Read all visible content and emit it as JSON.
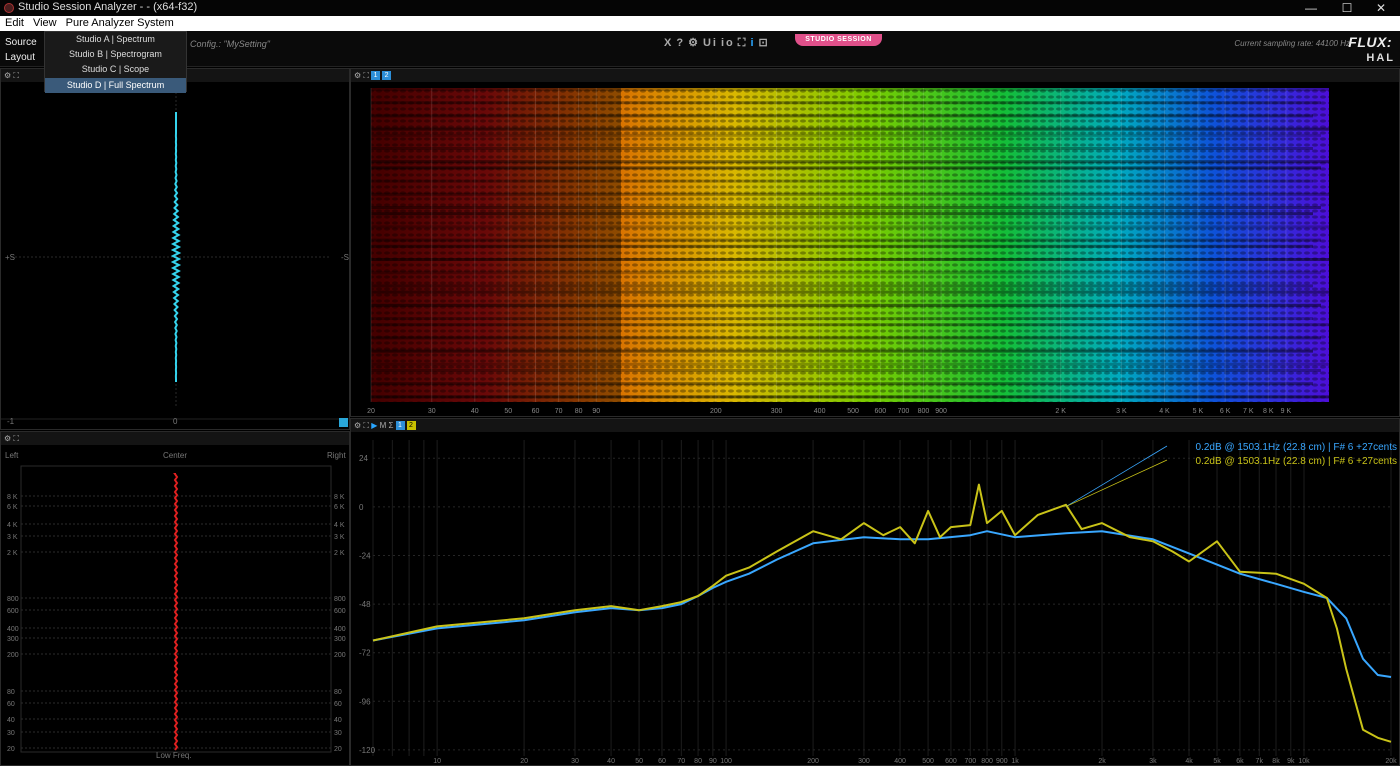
{
  "window": {
    "title": "Studio Session Analyzer -  -  (x64-f32)",
    "minimize": "—",
    "maximize": "☐",
    "close": "✕"
  },
  "menu": {
    "edit": "Edit",
    "view": "View",
    "pure": "Pure Analyzer System"
  },
  "toolbar": {
    "source": "Source",
    "layout": "Layout",
    "config": "Config.: \"MySetting\"",
    "icons": [
      "X",
      "?",
      "⚙",
      "Ui",
      "io",
      "⛶",
      "i",
      "⊡"
    ],
    "badge": "STUDIO SESSION",
    "sampling_rate": "Current sampling rate: 44100 Hz",
    "logo_top": "FLUX:",
    "logo_bottom": "HAL"
  },
  "layout_menu": [
    "Studio A | Spectrum",
    "Studio B | Spectrogram",
    "Studio C | Scope",
    "Studio D | Full Spectrum"
  ],
  "scope": {
    "label_plus": "+S",
    "label_minus": "-S",
    "bottom_left": "-1",
    "bottom_center": "0",
    "trace_color": "#35d4ee"
  },
  "spectrogram": {
    "freq_ticks": [
      [
        "20",
        20
      ],
      [
        "30",
        30
      ],
      [
        "40",
        40
      ],
      [
        "50",
        50
      ],
      [
        "60",
        60
      ],
      [
        "70",
        70
      ],
      [
        "80",
        80
      ],
      [
        "90",
        90
      ],
      [
        "200",
        200
      ],
      [
        "300",
        300
      ],
      [
        "400",
        400
      ],
      [
        "500",
        500
      ],
      [
        "600",
        600
      ],
      [
        "700",
        700
      ],
      [
        "800",
        800
      ],
      [
        "900",
        900
      ],
      [
        "2 K",
        2000
      ],
      [
        "3 K",
        3000
      ],
      [
        "4 K",
        4000
      ],
      [
        "5 K",
        5000
      ],
      [
        "6 K",
        6000
      ],
      [
        "7 K",
        7000
      ],
      [
        "8 K",
        8000
      ],
      [
        "9 K",
        9000
      ]
    ]
  },
  "stereo": {
    "left": "Left",
    "center": "Center",
    "right": "Right",
    "footer": "Low Freq.",
    "labels_left": [
      "8 K",
      "6 K",
      "4 K",
      "3 K",
      "2 K",
      "800",
      "600",
      "400",
      "300",
      "200",
      "80",
      "60",
      "40",
      "30",
      "20"
    ],
    "labels_right": [
      "8 K",
      "6 K",
      "4 K",
      "3 K",
      "2 K",
      "800",
      "600",
      "400",
      "300",
      "200",
      "80",
      "60",
      "40",
      "30",
      "20"
    ],
    "trace_color": "#e02020"
  },
  "chart_data": {
    "type": "line",
    "title": "",
    "xlabel": "",
    "ylabel": "",
    "x_scale": "log",
    "xlim": [
      6,
      20000
    ],
    "ylim": [
      -123,
      33
    ],
    "x_tick_labels": [
      [
        "10",
        10
      ],
      [
        "20",
        20
      ],
      [
        "30",
        30
      ],
      [
        "40",
        40
      ],
      [
        "50",
        50
      ],
      [
        "60",
        60
      ],
      [
        "70",
        70
      ],
      [
        "80",
        80
      ],
      [
        "90",
        90
      ],
      [
        "100",
        100
      ],
      [
        "200",
        200
      ],
      [
        "300",
        300
      ],
      [
        "400",
        400
      ],
      [
        "500",
        500
      ],
      [
        "600",
        600
      ],
      [
        "700",
        700
      ],
      [
        "800",
        800
      ],
      [
        "900",
        900
      ],
      [
        "1k",
        1000
      ],
      [
        "2k",
        2000
      ],
      [
        "3k",
        3000
      ],
      [
        "4k",
        4000
      ],
      [
        "5k",
        5000
      ],
      [
        "6k",
        6000
      ],
      [
        "7k",
        7000
      ],
      [
        "8k",
        8000
      ],
      [
        "9k",
        9000
      ],
      [
        "10k",
        10000
      ],
      [
        "20k",
        20000
      ]
    ],
    "y_ticks": [
      24,
      0,
      -24,
      -48,
      -72,
      -96,
      -120
    ],
    "grid": true,
    "readouts": [
      {
        "text": "0.2dB @  1503.1Hz (22.8 cm) | F# 6 +27cents",
        "color": "#39a7ff"
      },
      {
        "text": "0.2dB @  1503.1Hz (22.8 cm) | F# 6 +27cents",
        "color": "#c9c318"
      }
    ],
    "series": [
      {
        "color": "#39a7ff",
        "x": [
          6,
          10,
          20,
          30,
          40,
          50,
          60,
          70,
          80,
          90,
          100,
          120,
          150,
          200,
          300,
          400,
          500,
          700,
          800,
          1000,
          1500,
          2000,
          3000,
          4000,
          6000,
          8000,
          10000,
          12000,
          14000,
          16000,
          18000,
          20000
        ],
        "y": [
          -66,
          -60,
          -56,
          -52,
          -50,
          -51,
          -50,
          -48,
          -44,
          -40,
          -37,
          -33,
          -26,
          -18,
          -15,
          -16,
          -16,
          -14,
          -12,
          -15,
          -13,
          -12,
          -16,
          -23,
          -33,
          -38,
          -42,
          -45,
          -55,
          -75,
          -83,
          -84
        ]
      },
      {
        "color": "#c9c318",
        "x": [
          6,
          10,
          20,
          30,
          40,
          50,
          60,
          70,
          80,
          90,
          100,
          120,
          150,
          200,
          250,
          300,
          350,
          400,
          450,
          500,
          550,
          600,
          700,
          750,
          800,
          900,
          1000,
          1200,
          1500,
          1700,
          2000,
          2500,
          3000,
          3500,
          4000,
          5000,
          6000,
          8000,
          10000,
          12000,
          13000,
          14000,
          16000,
          18000,
          20000
        ],
        "y": [
          -66,
          -59,
          -55,
          -51,
          -49,
          -51,
          -49,
          -47,
          -44,
          -39,
          -34,
          -30,
          -22,
          -12,
          -16,
          -8,
          -14,
          -10,
          -18,
          -2,
          -15,
          -10,
          -9,
          11,
          -8,
          -2,
          -14,
          -4,
          1,
          -11,
          -8,
          -15,
          -17,
          -22,
          -27,
          -17,
          -32,
          -33,
          -38,
          -45,
          -60,
          -80,
          -110,
          -114,
          -116
        ]
      }
    ]
  }
}
